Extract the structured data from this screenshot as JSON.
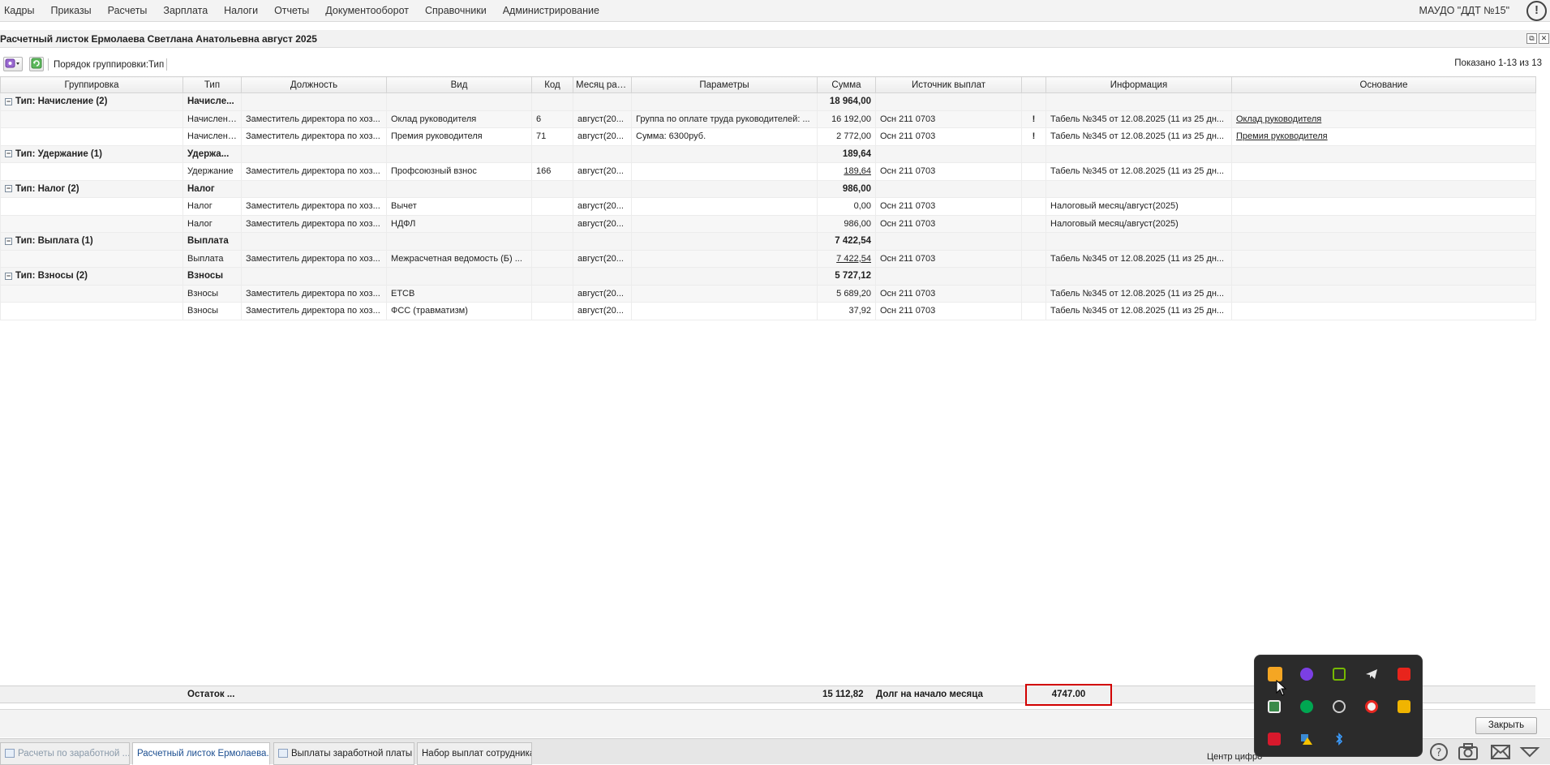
{
  "menu": {
    "items": [
      "Кадры",
      "Приказы",
      "Расчеты",
      "Зарплата",
      "Налоги",
      "Отчеты",
      "Документооборот",
      "Справочники",
      "Администрирование"
    ],
    "org_name": "МАУДО \"ДДТ №15\"",
    "alert_glyph": "!"
  },
  "window": {
    "title": "Расчетный листок Ермолаева Светлана Анатольевна август 2025",
    "restore_glyph": "⧉",
    "close_glyph": "✕"
  },
  "toolbar": {
    "grouping_label": "Порядок группировки:",
    "grouping_value": "Тип",
    "shown": "Показано 1-13 из 13"
  },
  "table": {
    "columns": [
      "Группировка",
      "Тип",
      "Должность",
      "Вид",
      "Код",
      "Месяц рас...",
      "Параметры",
      "Сумма",
      "Источник выплат",
      "",
      "Информация",
      "Основание"
    ],
    "groups": [
      {
        "label": "Тип: Начисление (2)",
        "type": "Начисле...",
        "sum": "18 964,00",
        "rows": [
          {
            "type": "Начисление",
            "position": "Заместитель директора по хоз...",
            "kind": "Оклад руководителя",
            "code": "6",
            "month": "август(20...",
            "params": "Группа по оплате труда руководителей: ...",
            "sum": "16 192,00",
            "source": "Осн 211 0703",
            "flag": "!",
            "info": "Табель №345 от 12.08.2025 (11 из 25 дн...",
            "basis": "Оклад руководителя"
          },
          {
            "type": "Начисление",
            "position": "Заместитель директора по хоз...",
            "kind": "Премия руководителя",
            "code": "71",
            "month": "август(20...",
            "params": "Сумма: 6300руб.",
            "sum": "2 772,00",
            "source": "Осн 211 0703",
            "flag": "!",
            "info": "Табель №345 от 12.08.2025 (11 из 25 дн...",
            "basis": "Премия руководителя"
          }
        ]
      },
      {
        "label": "Тип: Удержание (1)",
        "type": "Удержа...",
        "sum": "189,64",
        "rows": [
          {
            "type": "Удержание",
            "position": "Заместитель директора по хоз...",
            "kind": "Профсоюзный взнос",
            "code": "166",
            "month": "август(20...",
            "params": "",
            "sum": "189,64",
            "source": "Осн 211 0703",
            "flag": "",
            "info": "Табель №345 от 12.08.2025 (11 из 25 дн...",
            "basis": ""
          }
        ]
      },
      {
        "label": "Тип: Налог (2)",
        "type": "Налог",
        "sum": "986,00",
        "rows": [
          {
            "type": "Налог",
            "position": "Заместитель директора по хоз...",
            "kind": "Вычет",
            "code": "",
            "month": "август(20...",
            "params": "",
            "sum": "0,00",
            "source": "Осн 211 0703",
            "flag": "",
            "info": "Налоговый месяц/август(2025)",
            "basis": ""
          },
          {
            "type": "Налог",
            "position": "Заместитель директора по хоз...",
            "kind": "НДФЛ",
            "code": "",
            "month": "август(20...",
            "params": "",
            "sum": "986,00",
            "source": "Осн 211 0703",
            "flag": "",
            "info": "Налоговый месяц/август(2025)",
            "basis": ""
          }
        ]
      },
      {
        "label": "Тип: Выплата (1)",
        "type": "Выплата",
        "sum": "7 422,54",
        "rows": [
          {
            "type": "Выплата",
            "position": "Заместитель директора по хоз...",
            "kind": "Межрасчетная ведомость (Б) ...",
            "code": "",
            "month": "август(20...",
            "params": "",
            "sum": "7 422,54",
            "source": "Осн 211 0703",
            "flag": "",
            "info": "Табель №345 от 12.08.2025 (11 из 25 дн...",
            "basis": ""
          }
        ]
      },
      {
        "label": "Тип: Взносы (2)",
        "type": "Взносы",
        "sum": "5 727,12",
        "rows": [
          {
            "type": "Взносы",
            "position": "Заместитель директора по хоз...",
            "kind": "ЕТСВ",
            "code": "",
            "month": "август(20...",
            "params": "",
            "sum": "5 689,20",
            "source": "Осн 211 0703",
            "flag": "",
            "info": "Табель №345 от 12.08.2025 (11 из 25 дн...",
            "basis": ""
          },
          {
            "type": "Взносы",
            "position": "Заместитель директора по хоз...",
            "kind": "ФСС (травматизм)",
            "code": "",
            "month": "август(20...",
            "params": "",
            "sum": "37,92",
            "source": "Осн 211 0703",
            "flag": "",
            "info": "Табель №345 от 12.08.2025 (11 из 25 дн...",
            "basis": ""
          }
        ]
      }
    ]
  },
  "summary": {
    "label": "Остаток ...",
    "amount": "15 112,82",
    "debt_label": "Долг на начало месяца",
    "debt_value": "4747.00"
  },
  "bottom": {
    "close_label": "Закрыть"
  },
  "taskbar": {
    "tabs": [
      "Расчеты по заработной ...",
      "Расчетный листок Ермолаева...",
      "Выплаты заработной платы",
      "Набор выплат сотрудника"
    ],
    "tray_text": "Центр цифро"
  },
  "colors": {
    "highlight_border": "#d20000",
    "link": "#1a0dab",
    "flag": "#e00000",
    "popup_bg": "#2b2b2b"
  }
}
